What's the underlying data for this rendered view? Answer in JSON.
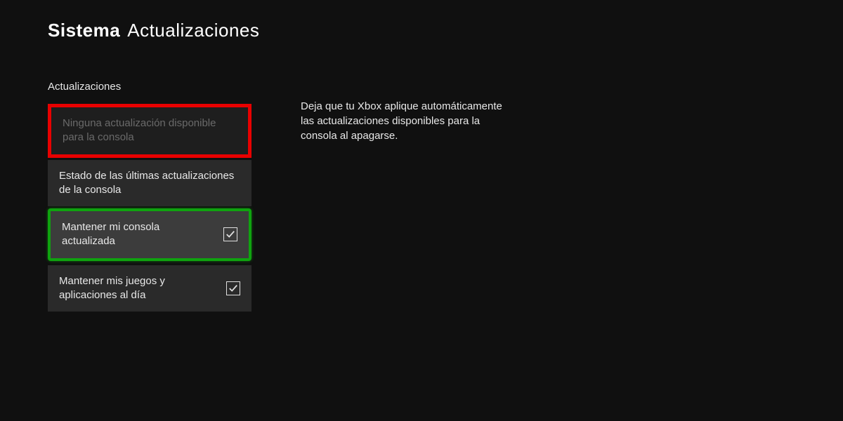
{
  "header": {
    "category": "Sistema",
    "page": "Actualizaciones"
  },
  "section": {
    "title": "Actualizaciones"
  },
  "options": {
    "noUpdate": {
      "label": "Ninguna actualización disponible para la consola"
    },
    "lastStatus": {
      "label": "Estado de las últimas actualizaciones de la consola"
    },
    "keepConsoleUpdated": {
      "label": "Mantener mi consola actualizada",
      "checked": true
    },
    "keepGamesUpdated": {
      "label": "Mantener mis juegos y aplicaciones al día",
      "checked": true
    }
  },
  "description": {
    "text": "Deja que tu Xbox aplique automáticamente las actualizaciones disponibles para la consola al apagarse."
  },
  "colors": {
    "background": "#101010",
    "itemBg": "#2a2a2a",
    "itemBgHighlight": "#3c3c3c",
    "itemBgDisabled": "#1e1e1e",
    "redBorder": "#e80000",
    "greenBorder": "#0fa30f",
    "text": "#e8e8e8",
    "textDisabled": "#6a6a6a"
  }
}
